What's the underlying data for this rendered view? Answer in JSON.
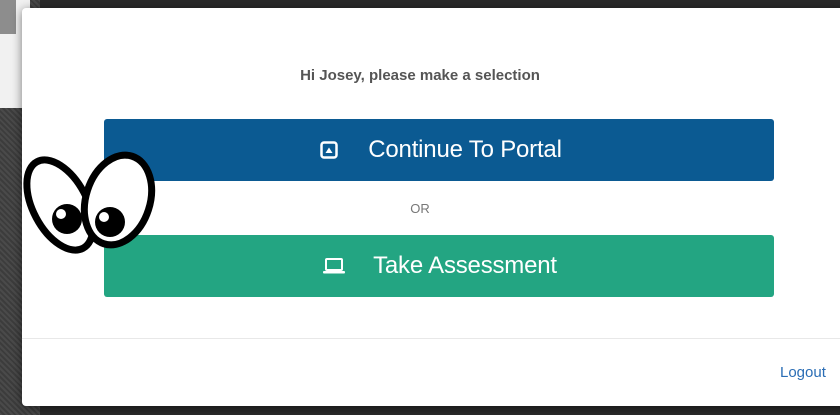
{
  "modal": {
    "greeting": "Hi Josey, please make a selection",
    "continue_button_label": "Continue To Portal",
    "continue_button_icon": "portal-icon",
    "separator": "OR",
    "assessment_button_label": "Take Assessment",
    "assessment_button_icon": "laptop-icon",
    "logout_label": "Logout"
  },
  "colors": {
    "continue_button": "#0b5a92",
    "assessment_button": "#23a582",
    "logout_link": "#2a6db5"
  },
  "decorations": {
    "overlay_sticker": "googly-eyes"
  }
}
